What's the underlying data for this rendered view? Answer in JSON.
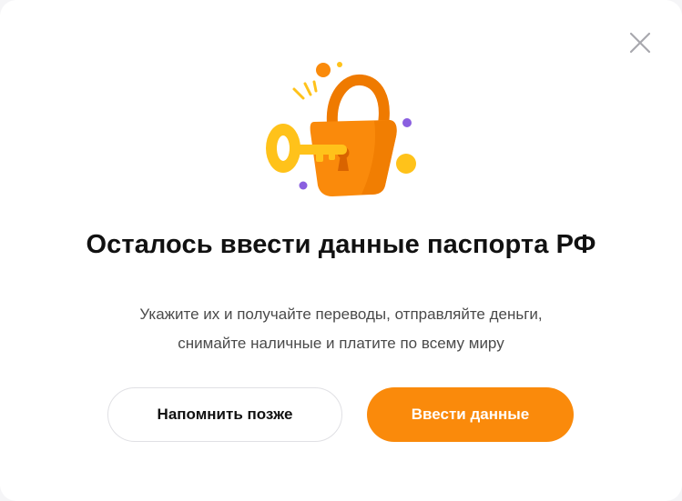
{
  "dialog": {
    "title": "Осталось ввести данные паспорта РФ",
    "description_line1": "Укажите их и получайте переводы, отправляйте деньги,",
    "description_line2": "снимайте наличные и платите по всему миру",
    "remind_later_label": "Напомнить позже",
    "enter_data_label": "Ввести данные",
    "close_icon": "close-icon",
    "illustration_icon": "unlocked-padlock-with-key-icon"
  },
  "colors": {
    "accent": "#fa8a0b",
    "lock_dark": "#ef7a00",
    "key_yellow": "#ffc21a",
    "dot_purple": "#8a5fe0",
    "title": "#111111",
    "text": "#4a4a4a"
  }
}
